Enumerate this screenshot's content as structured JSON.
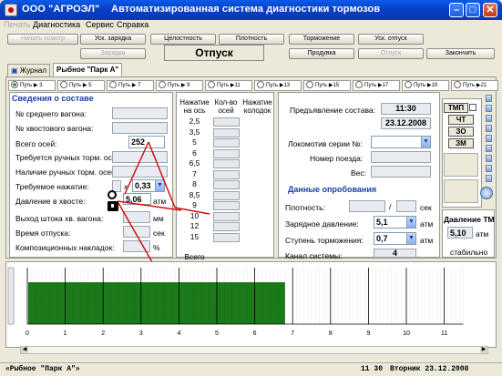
{
  "window": {
    "company": "ООО \"АГРОЭЛ\"",
    "title": "Автоматизированная система диагностики тормозов",
    "buttons": [
      "minimize",
      "maximize",
      "close"
    ]
  },
  "menu": [
    "Печать",
    "Диагностика",
    "Сервис",
    "Справка"
  ],
  "toolbar": {
    "start": "Начать осмотр",
    "charge_acc": "Уск. зарядка",
    "integrity": "Целостность",
    "density": "Плотность",
    "braking": "Торможение",
    "release_acc": "Уск. отпуск",
    "charge": "Зарядка",
    "mode": "Отпуск",
    "purge": "Продувка",
    "release": "Отпуск",
    "finish": "Закончить"
  },
  "tabs": [
    "Журнал",
    "Рыбное \"Парк А\""
  ],
  "ways": [
    "Путь ▶ 3",
    "Путь ▶ 5",
    "Путь ▶ 7",
    "Путь ▶ 9",
    "Путь ▶11",
    "Путь ▶13",
    "Путь ▶15",
    "Путь ▶17",
    "Путь ▶19",
    "Путь ▶21"
  ],
  "train_info": {
    "header": "Сведения о составе",
    "avg_car": "№ среднего вагона:",
    "tail_car": "№ хвостового вагона:",
    "axles_label": "Всего осей:",
    "axles_value": "252",
    "hand_required": "Требуется ручных торм. осей:",
    "hand_present": "Наличие ручных торм. осей:",
    "required_press_label": "Требуемое нажатие:",
    "required_press_x": "x",
    "required_press_value": "0,33",
    "tail_pressure_label": "Давление в хвосте:",
    "tail_pressure_value": "5,06",
    "tail_pressure_unit": "атм",
    "rod_label": "Выход штока хв. вагона:",
    "rod_unit": "мм",
    "release_time_label": "Время отпуска:",
    "release_time_unit": "сек",
    "pads_label": "Композиционных накладок:",
    "pads_unit": "%"
  },
  "axle_table": {
    "headers": [
      "Нажатие на ось",
      "Кол-во осей",
      "Нажатие колодок"
    ],
    "values": [
      "2,5",
      "3,5",
      "5",
      "6",
      "6,5",
      "7",
      "8",
      "8,5",
      "9",
      "10",
      "12",
      "15"
    ],
    "total": "Всего"
  },
  "presentation": {
    "label": "Предъявление состава:",
    "time": "11:30",
    "date": "23.12.2008",
    "loco_label": "Локомотив серии №:",
    "train_no_label": "Номер поезда:",
    "weight_label": "Вес:"
  },
  "test_data": {
    "header": "Данные опробования",
    "density_label": "Плотность:",
    "density_sep": "/",
    "density_unit": "сек",
    "charge_label": "Зарядное давление:",
    "charge_value": "5,1",
    "charge_unit": "атм",
    "stage_label": "Ступень торможения:",
    "stage_value": "0,7",
    "stage_unit": "атм",
    "channel_label": "Канал системы:",
    "channel_value": "4"
  },
  "indicators": [
    "ТМП",
    "ЧТ",
    "ЗО",
    "ЗМ"
  ],
  "tm_pressure": {
    "label": "Давление ТМ",
    "value": "5,10",
    "unit": "атм",
    "status": "стабильно"
  },
  "chart_data": {
    "type": "area",
    "x_ticks": [
      "0",
      "1",
      "2",
      "3",
      "4",
      "5",
      "6",
      "7",
      "8",
      "9",
      "10",
      "11"
    ],
    "fill_from": 0,
    "fill_to": 6.8,
    "color": "#1a7a1a"
  },
  "status": {
    "place": "«Рыбное \"Парк А\"»",
    "time": "11 30",
    "date": "Вторник 23.12.2008"
  }
}
